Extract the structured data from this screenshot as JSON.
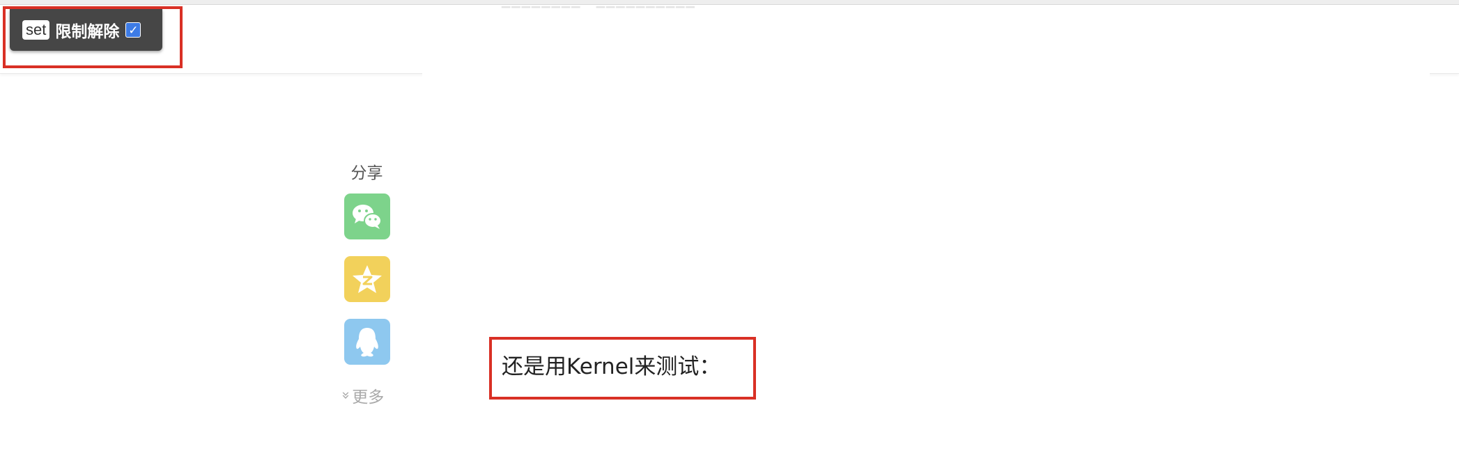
{
  "widget": {
    "tag": "set",
    "label": "限制解除",
    "check_mark": "✓",
    "checked": true
  },
  "share": {
    "title": "分享",
    "buttons": [
      {
        "name": "wechat",
        "icon": "wechat-icon",
        "color": "#7dd38b"
      },
      {
        "name": "qzone",
        "icon": "qzone-star-icon",
        "color": "#f2d15b"
      },
      {
        "name": "qq",
        "icon": "qq-penguin-icon",
        "color": "#8ec8ef"
      }
    ],
    "more_chevron": "»",
    "more_label": "更多"
  },
  "article": {
    "text": "还是用Kernel来测试："
  },
  "colors": {
    "highlight": "#d93025",
    "widget_bg": "#464646",
    "checkbox": "#3d7be5"
  }
}
